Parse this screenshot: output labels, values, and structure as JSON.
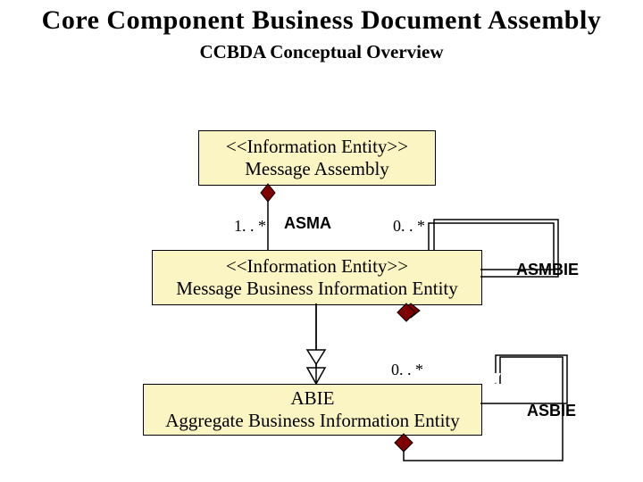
{
  "header": {
    "title": "Core Component Business Document Assembly",
    "subtitle": "CCBDA Conceptual Overview"
  },
  "boxes": {
    "msgAssembly": {
      "stereotype": "<<Information Entity>>",
      "name": "Message Assembly"
    },
    "mbie": {
      "stereotype": "<<Information Entity>>",
      "name": "Message Business Information Entity"
    },
    "abie": {
      "stereotype": "ABIE",
      "name": "Aggregate Business Information Entity"
    }
  },
  "labels": {
    "asma_mult": "1. . *",
    "asma": "ASMA",
    "mbie_self_mult": "0. . *",
    "asmbie": "ASMBIE",
    "abie_mult": "0. . *",
    "asbie": "ASBIE"
  },
  "relations": [
    {
      "from": "msgAssembly",
      "to": "mbie",
      "kind": "composition",
      "role": "ASMA",
      "mult": "1..*"
    },
    {
      "from": "mbie",
      "to": "mbie",
      "kind": "composition-self",
      "role": "ASMBIE",
      "mult": "0..*"
    },
    {
      "from": "mbie",
      "to": "abie",
      "kind": "generalization"
    },
    {
      "from": "abie",
      "to": "abie",
      "kind": "composition-self",
      "role": "ASBIE",
      "mult": "0..*"
    }
  ]
}
